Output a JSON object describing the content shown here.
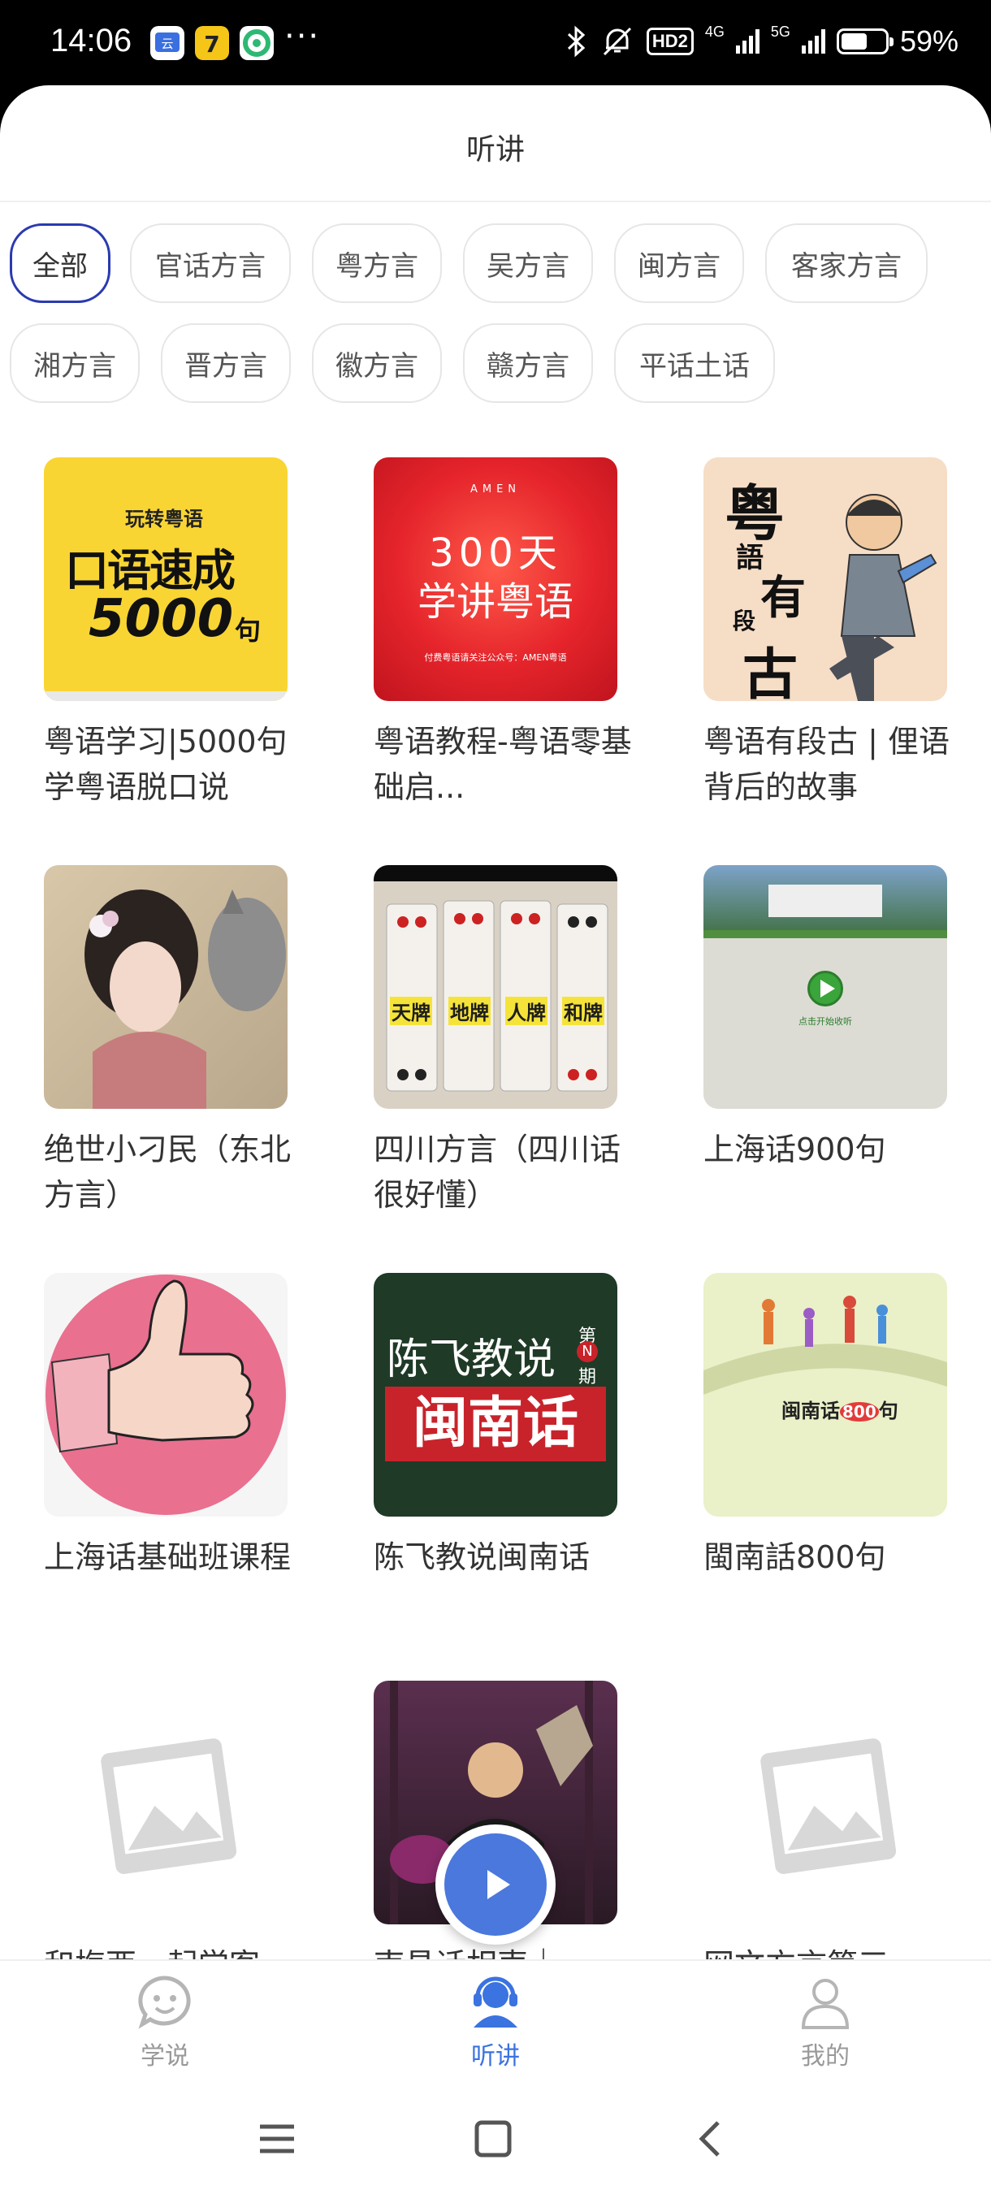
{
  "status_bar": {
    "time": "14:06",
    "more": "···",
    "net_4g": "4G",
    "net_5g": "5G",
    "hd": "HD2",
    "battery_text": "59%",
    "battery_level": 0.59
  },
  "header": {
    "title": "听讲"
  },
  "categories": [
    "全部",
    "官话方言",
    "粤方言",
    "吴方言",
    "闽方言",
    "客家方言",
    "湘方言",
    "晋方言",
    "徽方言",
    "赣方言",
    "平话土话"
  ],
  "selected_category": "全部",
  "cards": [
    {
      "title": "粤语学习|5000句学粤语脱口说",
      "cover_text": [
        "玩转粤语",
        "口语速成",
        "5000",
        "句"
      ]
    },
    {
      "title": "粤语教程-粤语零基础启...",
      "cover_text": [
        "AMEN",
        "300天",
        "学讲粤语",
        "付费粤语请关注公众号：AMEN粤语"
      ]
    },
    {
      "title": "粤语有段古 | 俚语背后的故事",
      "cover_text": [
        "粤",
        "語",
        "有",
        "段",
        "古"
      ]
    },
    {
      "title": "绝世小刁民（东北方言）",
      "cover_text": []
    },
    {
      "title": "四川方言（四川话很好懂）",
      "cover_text": [
        "天牌",
        "地牌",
        "人牌",
        "和牌"
      ]
    },
    {
      "title": "上海话900句",
      "cover_text": [
        "点击开始收听"
      ]
    },
    {
      "title": "上海话基础班课程",
      "cover_text": []
    },
    {
      "title": "陈飞教说闽南话",
      "cover_text": [
        "陈飞教说",
        "第",
        "N",
        "期",
        "闽南话"
      ]
    },
    {
      "title": "閩南話800句",
      "cover_text": [
        "闽南话",
        "800",
        "句"
      ]
    },
    {
      "title": "和梅西一起学客",
      "cover_text": []
    },
    {
      "title": "南昌话相声｜",
      "cover_text": []
    },
    {
      "title": "网文方言第三",
      "cover_text": []
    }
  ],
  "bottom_nav": [
    {
      "label": "学说",
      "icon": "smiley-chat-icon"
    },
    {
      "label": "听讲",
      "icon": "headset-user-icon",
      "active": true
    },
    {
      "label": "我的",
      "icon": "user-icon"
    }
  ],
  "colors": {
    "accent": "#3b73e0",
    "chip_active_border": "#2a3ab0"
  }
}
